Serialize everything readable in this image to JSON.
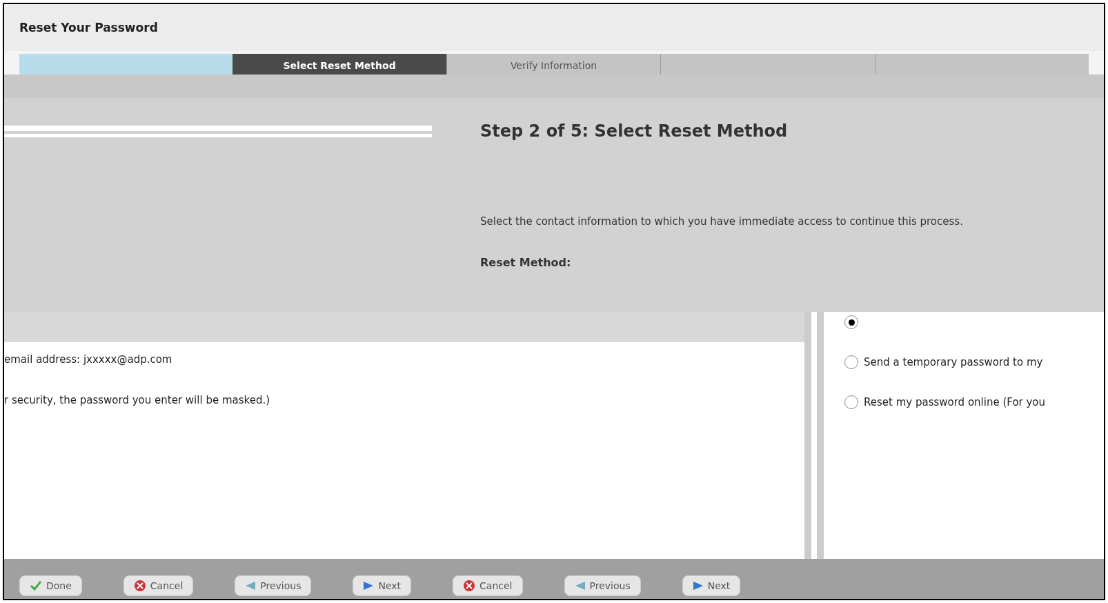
{
  "window": {
    "title": "Reset Your Password"
  },
  "tabs": [
    {
      "selected": false
    },
    {
      "label": "Select Reset Method",
      "selected": true
    },
    {
      "label": "Verify Information",
      "selected": false
    },
    {
      "selected": false
    },
    {
      "selected": false
    }
  ],
  "heading": "Step 2 of 5: Select Reset Method",
  "instruction": "Select the contact information to which you have immediate access to continue this process.",
  "reset_method_label": "Reset Method:",
  "details": [
    "email address: jxxxxx@adp.com",
    "r security, the password you enter will be masked.)"
  ],
  "options": [
    {
      "selected": true
    },
    {
      "label": "Send a temporary password to my",
      "selected": false
    },
    {
      "label": "Reset my password online (For you",
      "selected": false
    }
  ],
  "buttons": [
    {
      "label": "Done",
      "kind": "done"
    },
    {
      "label": "Cancel",
      "kind": "cancel"
    },
    {
      "label": "Previous",
      "kind": "previous"
    },
    {
      "label": "Next",
      "kind": "next"
    },
    {
      "label": "Cancel",
      "kind": "cancel"
    },
    {
      "label": "Previous",
      "kind": "previous"
    },
    {
      "label": "Next",
      "kind": "next"
    }
  ]
}
